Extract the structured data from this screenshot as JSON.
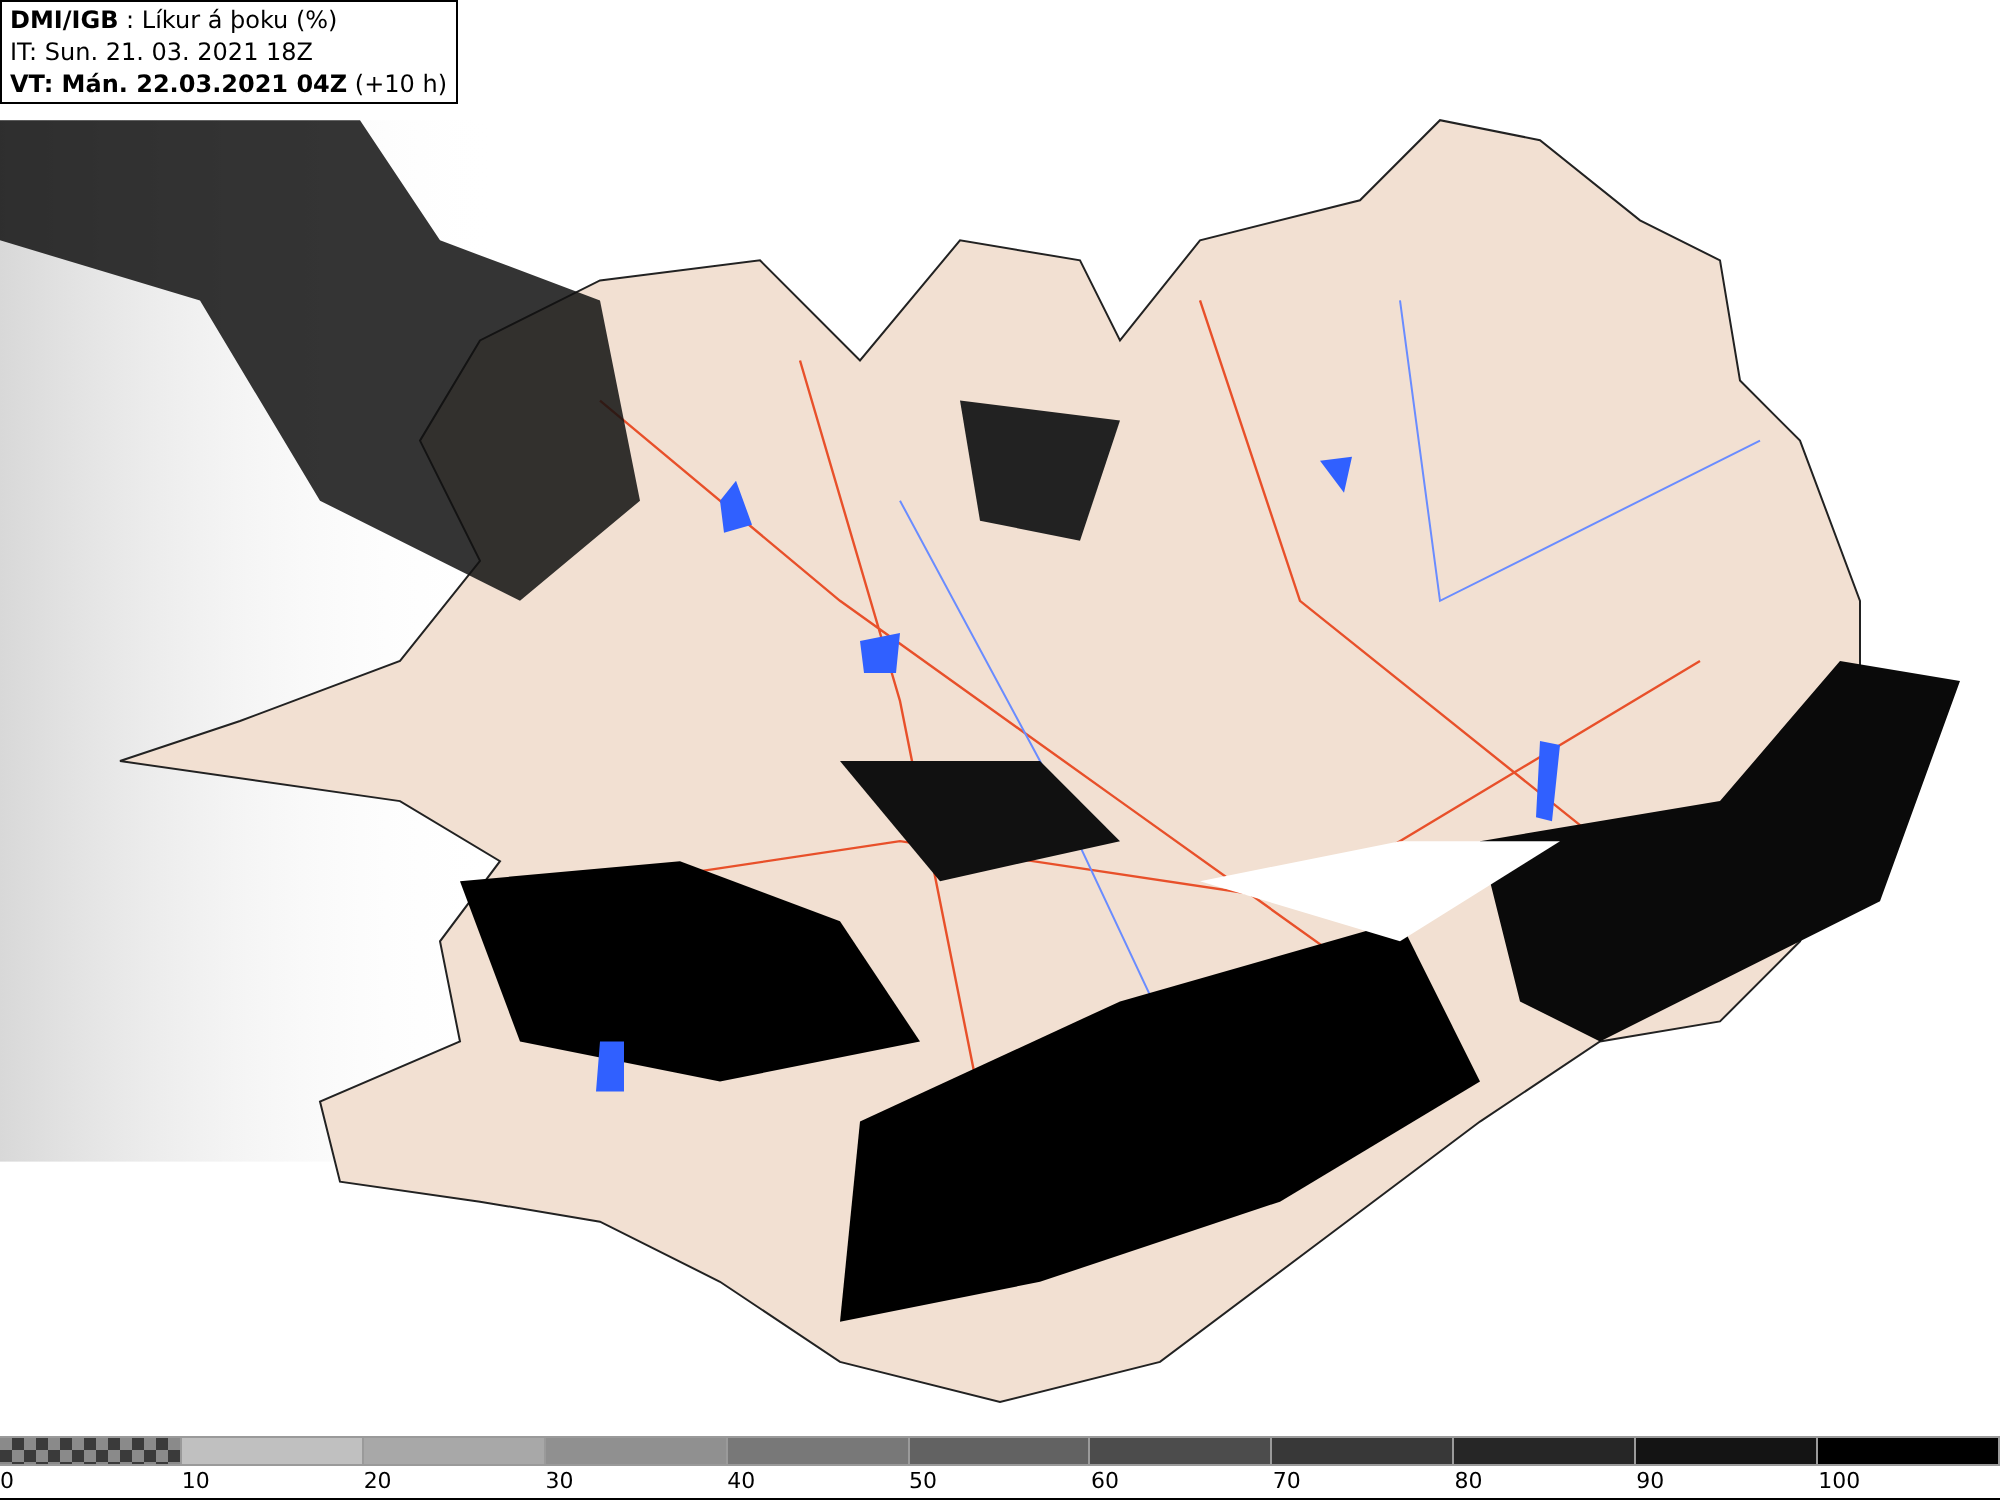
{
  "header": {
    "title": "**DMI/IGB** : Líkur á þoku (%)",
    "issue_time": "IT: Sun. 21. 03. 2021 18Z",
    "valid_time": "**VT: Mán. 22.03.2021 04Z** (+10 h)"
  },
  "legend": [
    {
      "kind": "checker",
      "color": "#8a8a8a",
      "label": "0"
    },
    {
      "kind": "solid",
      "color": "#c0c0c0",
      "label": "10"
    },
    {
      "kind": "solid",
      "color": "#a8a8a8",
      "label": "20"
    },
    {
      "kind": "solid",
      "color": "#909090",
      "label": "30"
    },
    {
      "kind": "solid",
      "color": "#787878",
      "label": "40"
    },
    {
      "kind": "solid",
      "color": "#626262",
      "label": "50"
    },
    {
      "kind": "solid",
      "color": "#4c4c4c",
      "label": "60"
    },
    {
      "kind": "solid",
      "color": "#383838",
      "label": "70"
    },
    {
      "kind": "solid",
      "color": "#262626",
      "label": "80"
    },
    {
      "kind": "solid",
      "color": "#141414",
      "label": "90"
    },
    {
      "kind": "solid",
      "color": "#000000",
      "label": "100"
    }
  ]
}
